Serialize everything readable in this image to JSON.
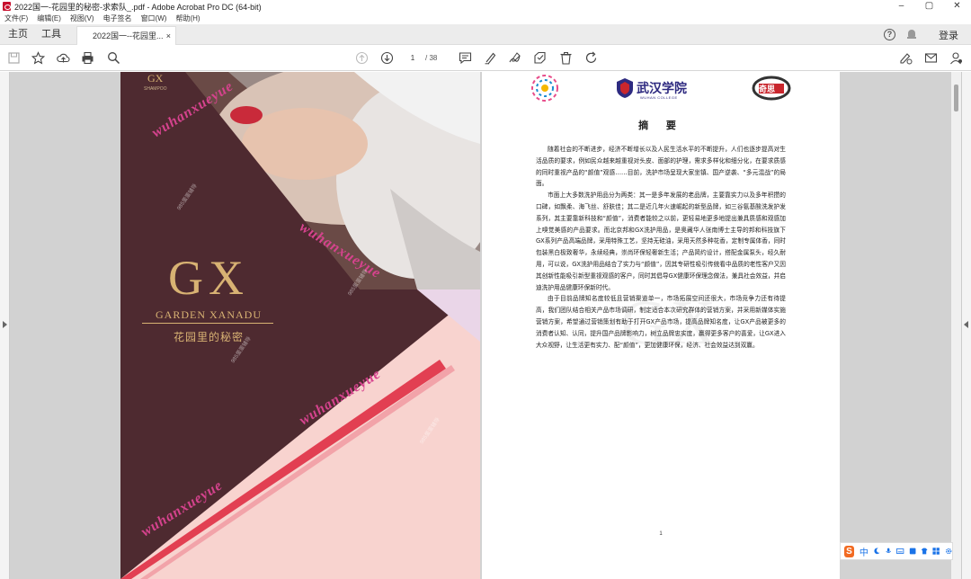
{
  "window": {
    "title": "2022国一-花园里的秘密-求索队_.pdf - Adobe Acrobat Pro DC (64-bit)",
    "controls": [
      "–",
      "▢",
      "✕"
    ]
  },
  "menubar": [
    "文件(F)",
    "编辑(E)",
    "视图(V)",
    "电子签名",
    "窗口(W)",
    "帮助(H)"
  ],
  "tabbar": {
    "home": "主页",
    "tools": "工具",
    "doc_tab": "2022国一--花园里...",
    "close": "×",
    "help_icon": "?",
    "login": "登录"
  },
  "toolbar": {
    "current_page": "1",
    "page_total": "/ 38"
  },
  "cover": {
    "brand_mark": "GX",
    "brand_name": "GARDEN XANADU",
    "brand_cn": "花园里的秘密",
    "top_label": "SHAMPOO",
    "watermarks": [
      "wuhanxueyue",
      "wuhanxueyue",
      "wuhanxueyue",
      "wuhanxueyue"
    ],
    "small_watermark": "985蛋蛋辅导"
  },
  "summary": {
    "logo_middle": "武汉学院",
    "logo_middle_en": "WUHAN COLLEGE",
    "logo_right": "奇思",
    "title": "摘 要",
    "paragraphs": [
      "随着社会的不断进步，经济不断增长以及人民生活水平的不断提升，人们也逐步提高对生活品质的要求，例如民众越来越重视对头皮、面部的护理，需求多样化和细分化，在要求质感的同时重视产品的“颜值”观感……目前，洗护市场呈现大家坐镇、国产逆袭、“多元混战”的局面。",
      "市面上大多数洗护用品分为两类：其一是多年发展的老品牌，主要靠实力以及多年积攒的口碑，如飘柔、海飞丝、舒肤佳；其二是近几年火速崛起的新型品牌，如三谷氨基酸洗发护发系列，其主要靠新科技和“颜值”，消费者能较之以前，更轻易地更多地提出兼具质感和观感加上嗅觉美感的产品要求。而北京邦和GX洗护用品，是奥藏华人张南博士主导的邦和科技旗下GX系列产品高端品牌，采用特殊工艺，坚持无硅油，采用天然多种花香，定制专属体香，同时包装黑白极致奢华，永续经典，崇尚环保轻奢新生活；产品简约设计，搭配金属泵头，经久耐用，可以说，GX洗护用品结合了实力与“颜值”，因其专研性吸引传统看中品质的老性客户又因其创新性能吸引新型重视观感的客户，同时其倡导GX健康环保理念做法，兼具社会效益，并启迪洗护用品健康环保新时代。",
      "由于目前品牌知名度较低且营销渠道单一，市场拓展空间还很大，市场竞争力还有待提高，我们团队结合相关产品市场调研，制定适合本次研究群体的营销方案，并采用新媒体实施营销方案，希望通过营销策划有助于打开GX产品市场，提高品牌知名度，让GX产品被更多的消费者认知、认同，提升国产品牌影响力，树立品牌忠实度，赢得更多客户的喜爱，让GX进入大众视野，让生活更有实力、配“颜值”，更加健康环保，经济、社会效益达到双赢。"
    ],
    "page_number": "1"
  },
  "ime": {
    "logo": "S",
    "mode": "中"
  },
  "colors": {
    "cover_dark": "#4e2a30",
    "cover_gold": "#d8b273",
    "cover_pink": "#f8d3cf",
    "cover_red": "#e23f52",
    "watermark_pink": "#d6438e",
    "acrobat_red": "#c8102e"
  }
}
